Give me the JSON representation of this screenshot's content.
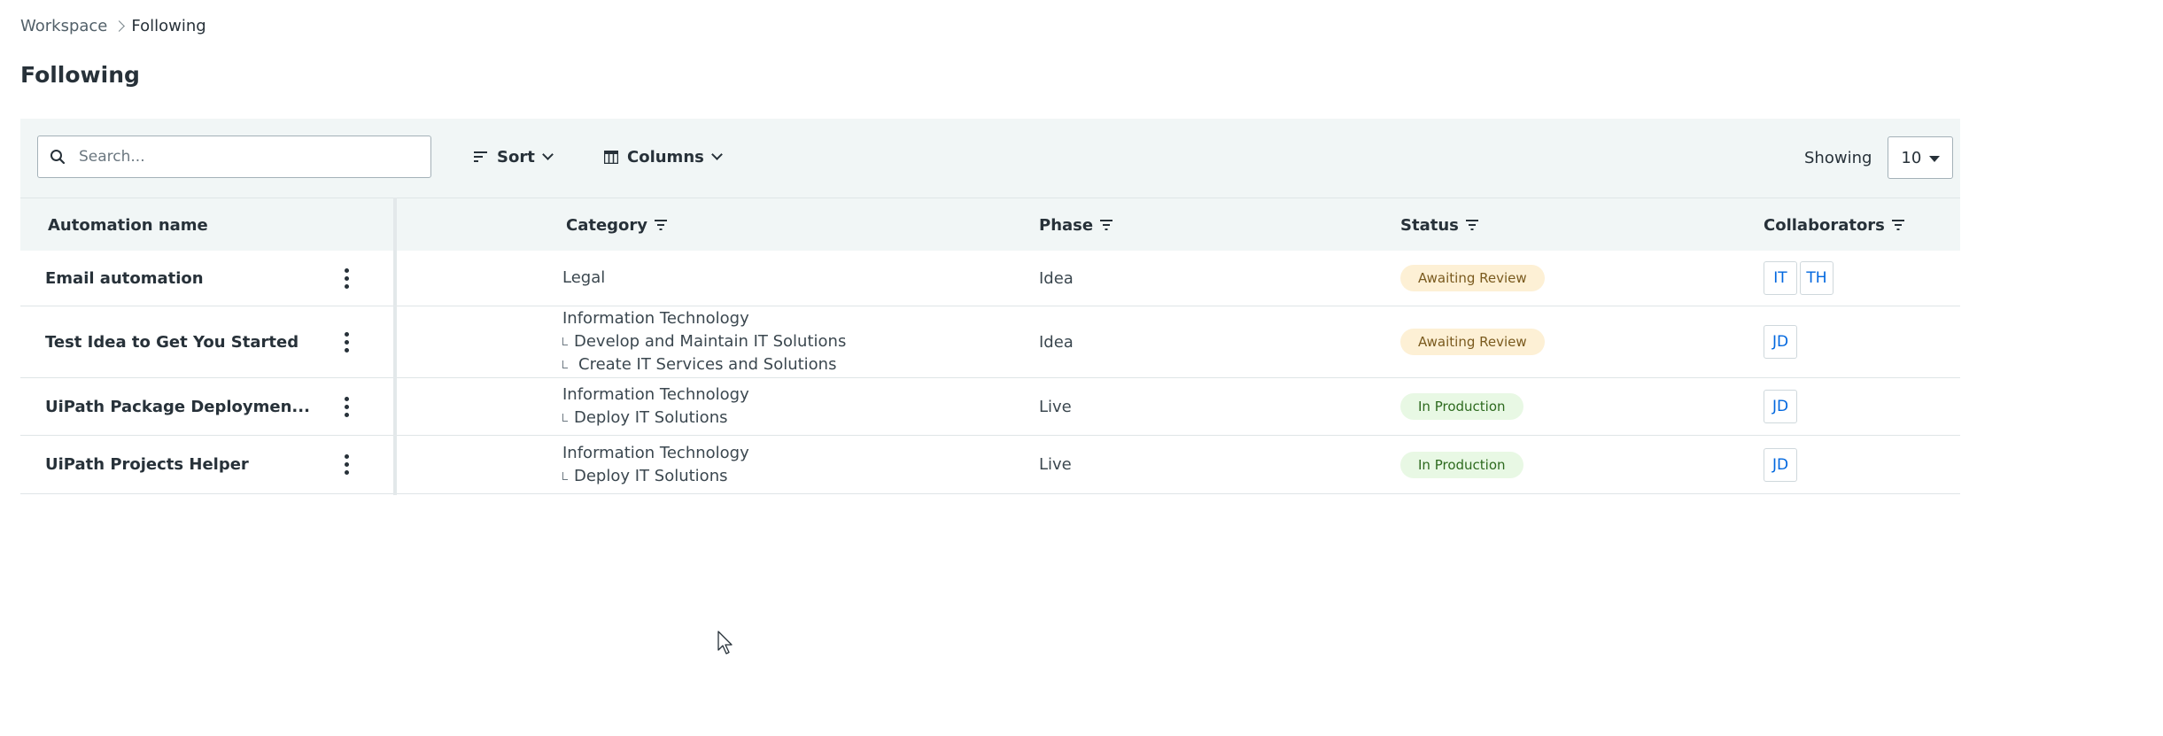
{
  "breadcrumb": {
    "parent": "Workspace",
    "current": "Following"
  },
  "page_title": "Following",
  "toolbar": {
    "search_placeholder": "Search...",
    "sort_label": "Sort",
    "columns_label": "Columns",
    "showing_label": "Showing",
    "page_size": "10"
  },
  "table": {
    "headers": {
      "name": "Automation name",
      "category": "Category",
      "phase": "Phase",
      "status": "Status",
      "collaborators": "Collaborators"
    },
    "rows": [
      {
        "name": "Email automation",
        "category": [
          "Legal"
        ],
        "phase": "Idea",
        "status": "Awaiting Review",
        "collaborators": [
          "IT",
          "TH"
        ]
      },
      {
        "name": "Test Idea to Get You Started",
        "category": [
          "Information Technology",
          "Develop and Maintain IT Solutions",
          "Create IT Services and Solutions"
        ],
        "phase": "Idea",
        "status": "Awaiting Review",
        "collaborators": [
          "JD"
        ]
      },
      {
        "name": "UiPath Package Deploymen...",
        "category": [
          "Information Technology",
          "Deploy IT Solutions"
        ],
        "phase": "Live",
        "status": "In Production",
        "collaborators": [
          "JD"
        ]
      },
      {
        "name": "UiPath Projects Helper",
        "category": [
          "Information Technology",
          "Deploy IT Solutions"
        ],
        "phase": "Live",
        "status": "In Production",
        "collaborators": [
          "JD"
        ]
      }
    ]
  },
  "colors": {
    "toolbar_bg": "#f1f6f6",
    "awaiting_review_bg": "#fdf0d5",
    "in_production_bg": "#e8f8e4",
    "avatar_text": "#0067df"
  }
}
